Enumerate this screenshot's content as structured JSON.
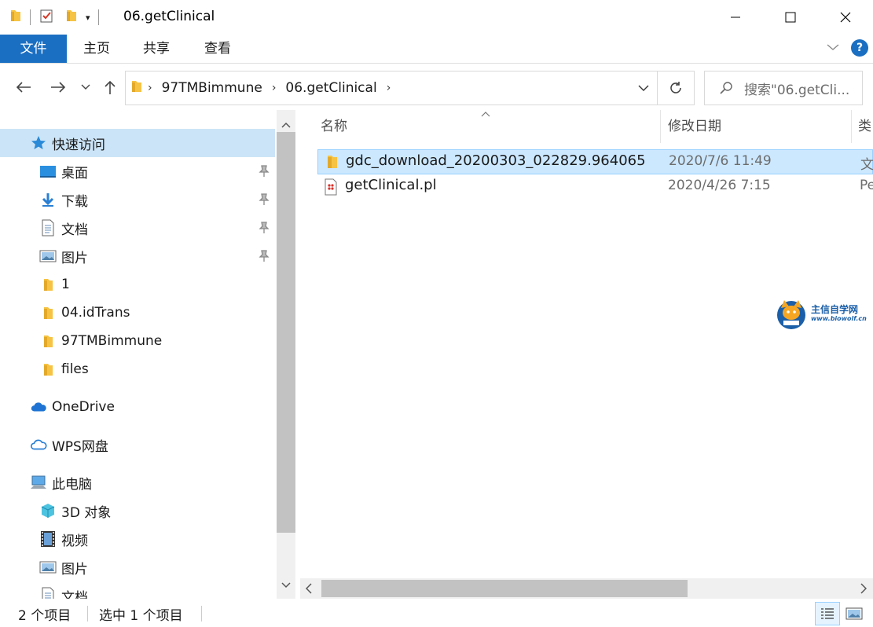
{
  "window": {
    "title": "06.getClinical"
  },
  "ribbon": {
    "tabs": [
      {
        "label": "文件"
      },
      {
        "label": "主页"
      },
      {
        "label": "共享"
      },
      {
        "label": "查看"
      }
    ]
  },
  "address": {
    "segments": [
      "97TMBimmune",
      "06.getClinical"
    ]
  },
  "search": {
    "placeholder": "搜索\"06.getCli..."
  },
  "sidebar": {
    "quick_access": "快速访问",
    "items": [
      {
        "label": "桌面",
        "icon": "desktop-icon",
        "pinned": true
      },
      {
        "label": "下载",
        "icon": "download-icon",
        "pinned": true
      },
      {
        "label": "文档",
        "icon": "document-icon",
        "pinned": true
      },
      {
        "label": "图片",
        "icon": "pictures-icon",
        "pinned": true
      },
      {
        "label": "1",
        "icon": "folder-icon",
        "pinned": false
      },
      {
        "label": "04.idTrans",
        "icon": "folder-icon",
        "pinned": false
      },
      {
        "label": "97TMBimmune",
        "icon": "folder-icon",
        "pinned": false
      },
      {
        "label": "files",
        "icon": "folder-icon",
        "pinned": false
      }
    ],
    "onedrive": "OneDrive",
    "wps": "WPS网盘",
    "this_pc": "此电脑",
    "pc_items": [
      {
        "label": "3D 对象",
        "icon": "3d-objects-icon"
      },
      {
        "label": "视频",
        "icon": "video-icon"
      },
      {
        "label": "图片",
        "icon": "pictures-icon"
      },
      {
        "label": "文档",
        "icon": "document-icon"
      }
    ]
  },
  "columns": {
    "name": "名称",
    "date": "修改日期",
    "type": "类"
  },
  "files": [
    {
      "name": "gdc_download_20200303_022829.964065",
      "date": "2020/7/6 11:49",
      "type": "文",
      "icon": "folder-icon",
      "selected": true
    },
    {
      "name": "getClinical.pl",
      "date": "2020/4/26 7:15",
      "type": "Pe",
      "icon": "perl-file-icon",
      "selected": false
    }
  ],
  "watermark": {
    "line1": "主信自学网",
    "line2": "www.biowolf.cn"
  },
  "status": {
    "count": "2 个项目",
    "selected": "选中 1 个项目"
  },
  "colors": {
    "accent": "#1b6fc2",
    "selection": "#cce8ff",
    "nav_selection": "#cce4f7",
    "folder": "#f6c343"
  }
}
